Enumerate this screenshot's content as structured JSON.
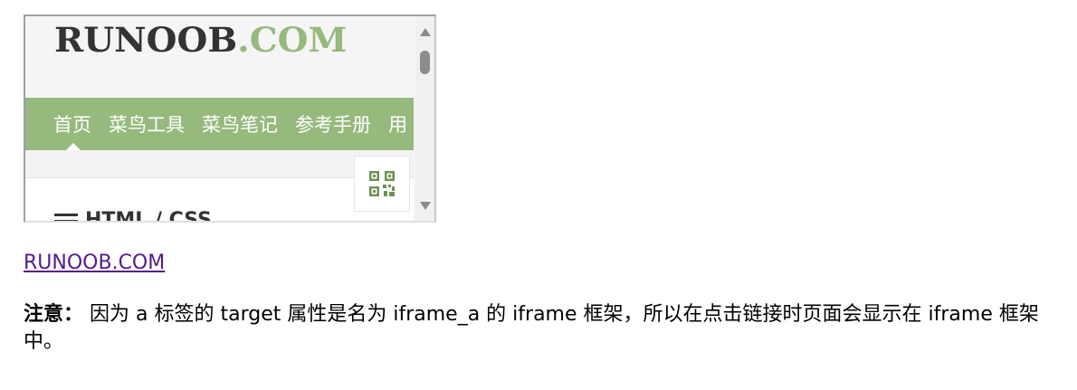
{
  "iframe": {
    "logo_main": "RUNOOB",
    "logo_accent": ".COM",
    "nav_items": [
      "首页",
      "菜鸟工具",
      "菜鸟笔记",
      "参考手册",
      "用"
    ],
    "section_heading": "HTML / CSS",
    "qr_icon": "qr-code-icon",
    "colors": {
      "brand_green": "#96b97d",
      "logo_dark": "#333333",
      "background": "#f5f5f5"
    }
  },
  "link": {
    "text": "RUNOOB.COM",
    "color": "#551a8b"
  },
  "note": {
    "label": "注意：",
    "text": " 因为 a 标签的 target 属性是名为 iframe_a 的 iframe 框架，所以在点击链接时页面会显示在 iframe 框架中。"
  }
}
